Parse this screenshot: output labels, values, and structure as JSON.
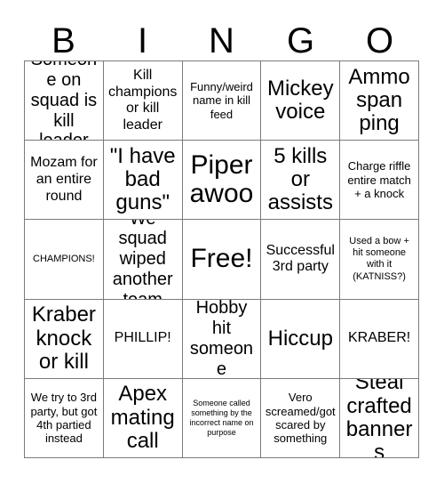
{
  "card": {
    "title": "BINGO",
    "header_letters": [
      "B",
      "I",
      "N",
      "G",
      "O"
    ],
    "grid_size": 5,
    "border_color": "#7b7b7b",
    "text_color": "#000000",
    "background_color": "#ffffff",
    "free_space": {
      "row": 3,
      "column": 3,
      "label": "Free!"
    },
    "rows": [
      [
        {
          "text": "Someone on squad is kill leader",
          "size": "lg"
        },
        {
          "text": "Kill champions or kill leader",
          "size": "md"
        },
        {
          "text": "Funny/weird name in kill feed",
          "size": "sm"
        },
        {
          "text": "Mickey voice",
          "size": "xl"
        },
        {
          "text": "Ammo span ping",
          "size": "xl"
        }
      ],
      [
        {
          "text": "Mozam for an entire round",
          "size": "md"
        },
        {
          "text": "\"I have bad guns\"",
          "size": "xl"
        },
        {
          "text": "Piper awoo",
          "size": "xxl"
        },
        {
          "text": "5 kills or assists",
          "size": "xl"
        },
        {
          "text": "Charge riffle entire match + a knock",
          "size": "sm"
        }
      ],
      [
        {
          "text": "CHAMPIONS!",
          "size": "xs"
        },
        {
          "text": "We squad wiped another team",
          "size": "lg"
        },
        {
          "text": "Free!",
          "size": "xxl"
        },
        {
          "text": "Successful 3rd party",
          "size": "md"
        },
        {
          "text": "Used a bow + hit someone with it (KATNISS?)",
          "size": "xs"
        }
      ],
      [
        {
          "text": "Kraber knock or kill",
          "size": "xl"
        },
        {
          "text": "PHILLIP!",
          "size": "md"
        },
        {
          "text": "Hobby hit someone",
          "size": "lg"
        },
        {
          "text": "Hiccup",
          "size": "xl"
        },
        {
          "text": "KRABER!",
          "size": "md"
        }
      ],
      [
        {
          "text": "We try to 3rd party, but got 4th partied instead",
          "size": "sm"
        },
        {
          "text": "Apex mating call",
          "size": "xl"
        },
        {
          "text": "Someone called something by the incorrect name on purpose",
          "size": "xxs"
        },
        {
          "text": "Vero screamed/got scared by something",
          "size": "sm"
        },
        {
          "text": "Steal crafted banners",
          "size": "xl"
        }
      ]
    ]
  }
}
